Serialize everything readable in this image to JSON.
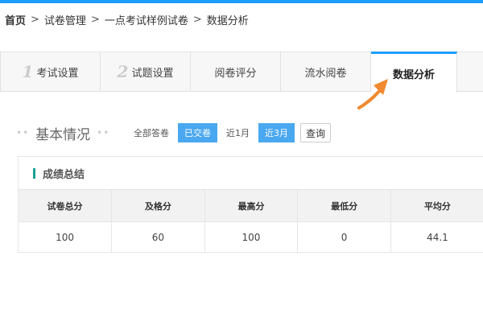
{
  "breadcrumb": {
    "items": [
      "首页",
      "试卷管理",
      "一点考试样例试卷",
      "数据分析"
    ],
    "separator": ">"
  },
  "tabs": [
    {
      "num": "1",
      "label": "考试设置",
      "active": false
    },
    {
      "num": "2",
      "label": "试题设置",
      "active": false
    },
    {
      "num": "",
      "label": "阅卷评分",
      "active": false
    },
    {
      "num": "",
      "label": "流水阅卷",
      "active": false
    },
    {
      "num": "",
      "label": "数据分析",
      "active": true
    }
  ],
  "section": {
    "dots": "•• ",
    "title": "基本情况",
    "dots_after": " ••"
  },
  "filters": {
    "items": [
      "全部答卷",
      "已交卷",
      "近1月",
      "近3月"
    ],
    "active": [
      "已交卷",
      "近3月"
    ],
    "query_label": "查询"
  },
  "panel": {
    "title": "成绩总结",
    "columns": [
      "试卷总分",
      "及格分",
      "最高分",
      "最低分",
      "平均分"
    ],
    "row": [
      "100",
      "60",
      "100",
      "0",
      "44.1"
    ]
  },
  "colors": {
    "accent": "#1e9fff",
    "filter_active": "#4aa8f0",
    "arrow": "#f0892f",
    "panel_bar": "#1aa094"
  }
}
